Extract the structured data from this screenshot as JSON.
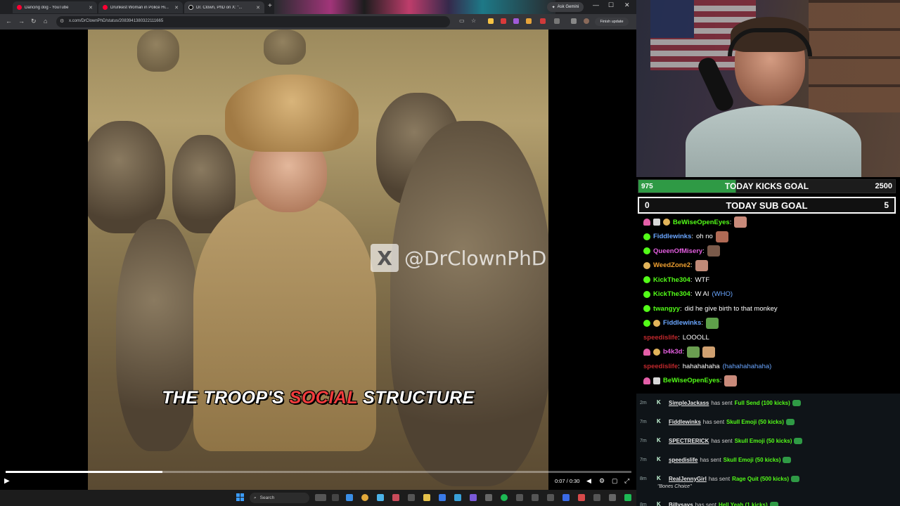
{
  "browser": {
    "tabs": [
      {
        "label": "Dancing dog - YouTube",
        "favicon": "youtube-icon"
      },
      {
        "label": "Drunkest Woman in Police Hi...",
        "favicon": "youtube-icon"
      },
      {
        "label": "Dr. Clown, PhD on X: \"...",
        "favicon": "x-icon"
      }
    ],
    "ask_label": "Ask Gemini",
    "url": "x.com/DrClownPhD/status/2083941380322111665",
    "update_label": "Finish update"
  },
  "video": {
    "watermark": "@DrClownPhD",
    "caption_before": "THE TROOP'S ",
    "caption_highlight": "SOCIAL",
    "caption_after": " STRUCTURE",
    "time": "0:07 / 0:30",
    "progress": 0.25
  },
  "taskbar": {
    "search_label": "Search"
  },
  "goals": {
    "kicks": {
      "current": "975",
      "label": "TODAY KICKS GOAL",
      "target": "2500"
    },
    "subs": {
      "current": "0",
      "label": "TODAY SUB GOAL",
      "target": "5"
    }
  },
  "chat": [
    {
      "user": "BeWiseOpenEyes",
      "sep": ":",
      "text": "",
      "color": "#53fc18",
      "badges": [
        "vip",
        "gift",
        "og"
      ],
      "emote": "#c98a7a"
    },
    {
      "user": "Fiddlewinks",
      "sep": ":",
      "text": "oh no",
      "color": "#6aa6ff",
      "badges": [
        "sub"
      ],
      "emote": "#b06a55"
    },
    {
      "user": "QueenOfMisery",
      "sep": ":",
      "text": "",
      "color": "#e45fe0",
      "badges": [
        "sub"
      ],
      "emote": "#7a5a4a"
    },
    {
      "user": "WeedZone2",
      "sep": ":",
      "text": "",
      "color": "#f0a030",
      "badges": [
        "og"
      ],
      "emote": "#c08a78"
    },
    {
      "user": "KickThe304",
      "sep": ":",
      "text": "WTF",
      "color": "#53fc18",
      "badges": [
        "sub"
      ]
    },
    {
      "user": "KickThe304",
      "sep": ":",
      "text": "W AI",
      "mention": "(WHO)",
      "color": "#53fc18",
      "badges": [
        "sub"
      ]
    },
    {
      "user": "twangyy",
      "sep": ":",
      "text": "did he give birth to that monkey",
      "color": "#53fc18",
      "badges": [
        "sub"
      ]
    },
    {
      "user": "Fiddlewinks",
      "sep": ":",
      "text": "",
      "color": "#6aa6ff",
      "badges": [
        "sub",
        "og"
      ],
      "emote": "#5ea04a"
    },
    {
      "user": "speedislife",
      "sep": ":",
      "text": "LOOOLL",
      "color": "#c0282c",
      "badges": []
    },
    {
      "user": "b4k3d",
      "sep": ":",
      "text": "",
      "color": "#e45fe0",
      "badges": [
        "vip",
        "og"
      ],
      "emote": "#6a9e50",
      "emote2": "#d0a070"
    },
    {
      "user": "speedislife",
      "sep": ":",
      "text": "hahahahaha",
      "mention": "(hahahahahaha)",
      "color": "#c0282c",
      "badges": []
    },
    {
      "user": "BeWiseOpenEyes",
      "sep": ":",
      "text": "",
      "color": "#53fc18",
      "badges": [
        "vip",
        "gift"
      ],
      "emote": "#c98a7a"
    }
  ],
  "events": [
    {
      "time": "2m",
      "user": "SimpleJackass",
      "verb": "has sent",
      "gift": "Full Send (100 kicks)"
    },
    {
      "time": "7m",
      "user": "Fiddlewinks",
      "verb": "has sent",
      "gift": "Skull Emoji (50 kicks)"
    },
    {
      "time": "7m",
      "user": "SPECTRERICK",
      "verb": "has sent",
      "gift": "Skull Emoji (50 kicks)"
    },
    {
      "time": "7m",
      "user": "speedislife",
      "verb": "has sent",
      "gift": "Skull Emoji (50 kicks)"
    },
    {
      "time": "8m",
      "user": "RealJennyGirl",
      "verb": "has sent",
      "gift": "Rage Quit (500 kicks)",
      "note": "\"Bones Choice\""
    },
    {
      "time": "8m",
      "user": "Billysays",
      "verb": "has sent",
      "gift": "Hell Yeah (1 kicks)"
    }
  ]
}
